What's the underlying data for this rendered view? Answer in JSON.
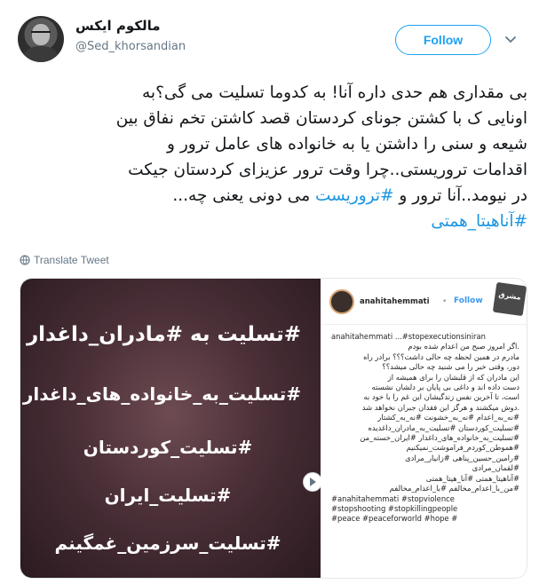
{
  "author": {
    "name": "مالکوم ایکس",
    "handle": "@Sed_khorsandian"
  },
  "actions": {
    "follow_label": "Follow"
  },
  "tweet": {
    "lines": [
      "بی مقداری هم حدی داره آنا! به کدوما تسلیت می گی؟به",
      "اونایی ک با کشتن جونای کردستان قصد کاشتن تخم نفاق بین",
      "شیعه و سنی را داشتن یا به خانواده های عامل ترور و",
      "اقدامات تروریستی..چرا وقت ترور عزیزای کردستان جیکت"
    ],
    "line5_before": "در نیومد..آنا ترور و ",
    "line5_tag": "#تروریست",
    "line5_after": " می دونی یعنی چه...",
    "hashtag": "#آناهیتا_همتی"
  },
  "translate_label": "Translate Tweet",
  "media": {
    "condolences": [
      "#تسلیت به #مادران_داغدار",
      "#تسلیت_به_خانواده_های_داغدار",
      "#تسلیت_کوردستان",
      "#تسلیت_ایران",
      "#تسلیت_سرزمین_غمگینم"
    ],
    "instagram": {
      "username": "anahitahemmati",
      "follow_label": "Follow",
      "logo_text": "مشرق",
      "caption_lines": [
        "anahitahemmati ...#stopexecutionsiniran",
        ".اگر امروز صبح من اعدام شده بودم",
        "مادرم در همین لحظه چه حالی داشت؟؟؟ برادر راه",
        "دور، وقتی خبر را می شنید چه حالی میشد؟؟",
        "این مادران که از قلبشان را برای همیشه از",
        "دست داده اند و داغی بی پایان بر دلشان نشسته",
        "است، تا آخرین نفس زندگیشان این غم را با خود به",
        ".دوش میکشند و هرگز این فقدان جبران نخواهد شد",
        "#نه_به_اعدام #نه_به_خشونت #نه_به_کشتار",
        "#تسلیت_کوردستان #تسلیت_به_مادران_داغدیده",
        "#تسلیت_به_خانواده_های_داغدار #ایران_خسته_من",
        "#هموطن_کوردم_فراموشت_نمیکنیم",
        "#رامین_حسین_پناهی #زانیار_مرادی",
        "#لقمان_مرادی",
        "#آناهیتا_همتی #آنا_هیتا_همتی",
        "#من_با_اعدام_مخالفم #با_اعدام_مخالفم",
        "#anahitahemmati #stopviolence",
        "#stopshooting #stopkillingpeople",
        "#peace #peaceforworld #hope #"
      ]
    }
  }
}
